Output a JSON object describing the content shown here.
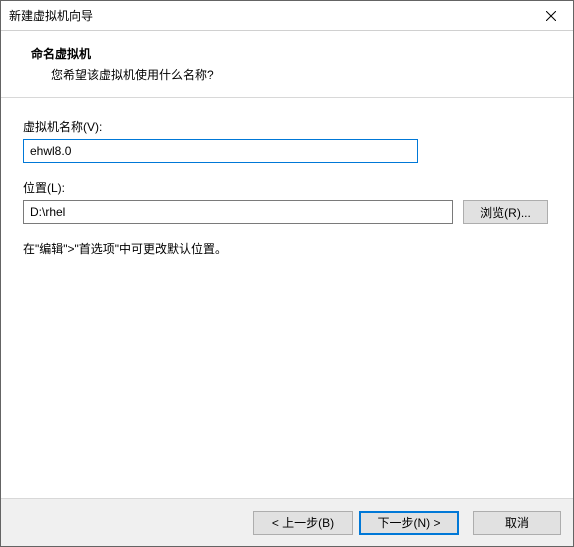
{
  "titlebar": {
    "title": "新建虚拟机向导"
  },
  "header": {
    "title": "命名虚拟机",
    "subtitle": "您希望该虚拟机使用什么名称?"
  },
  "fields": {
    "name_label": "虚拟机名称(V):",
    "name_value": "ehwl8.0",
    "location_label": "位置(L):",
    "location_value": "D:\\rhel",
    "browse_label": "浏览(R)..."
  },
  "hint": "在\"编辑\">\"首选项\"中可更改默认位置。",
  "footer": {
    "back": "< 上一步(B)",
    "next": "下一步(N) >",
    "cancel": "取消"
  }
}
